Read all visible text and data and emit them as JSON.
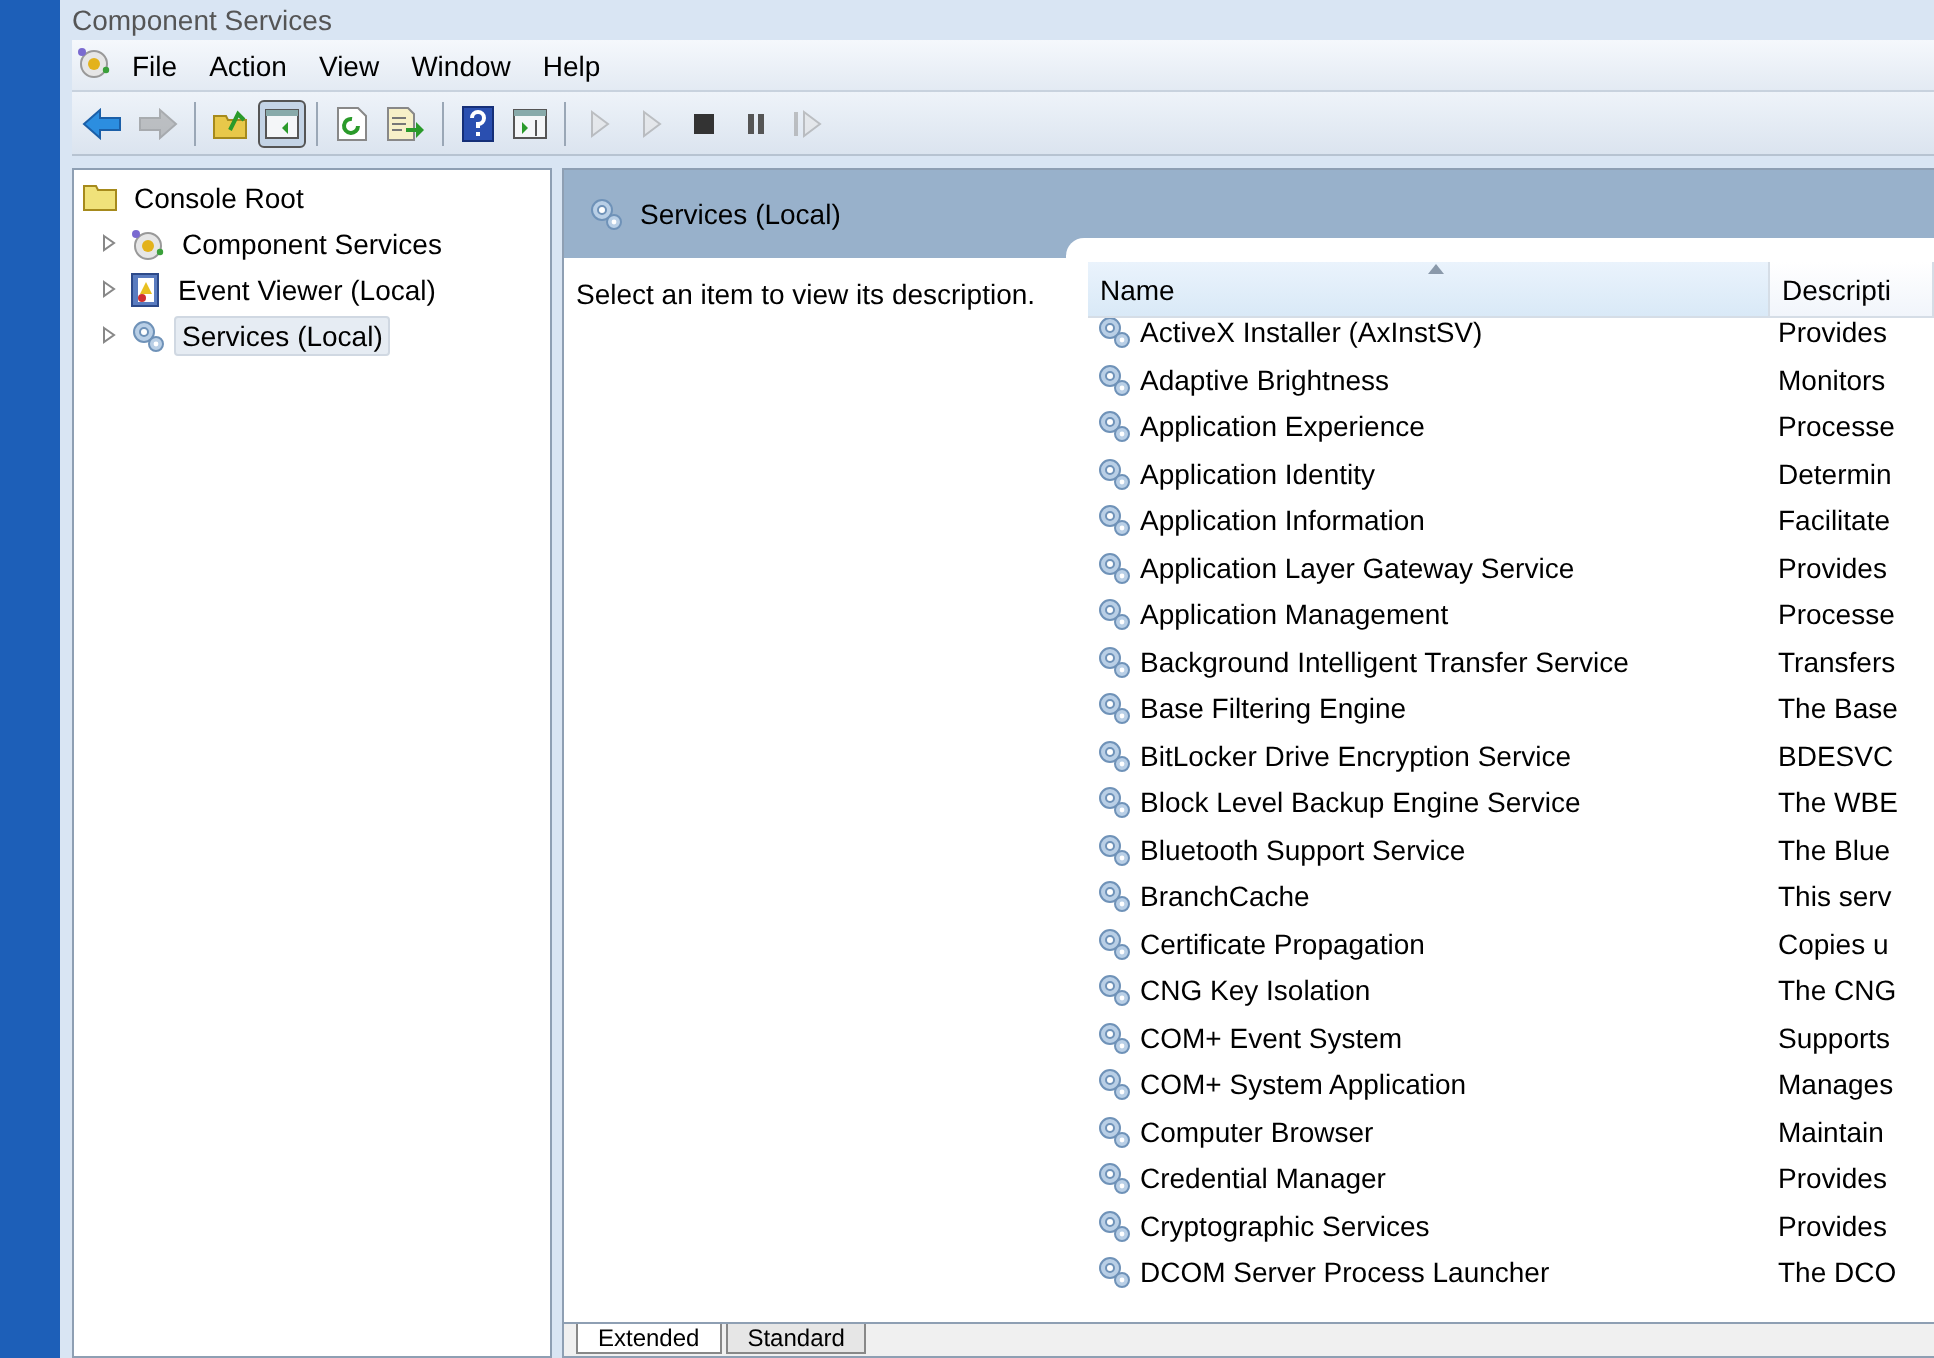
{
  "window": {
    "title": "Component Services"
  },
  "menu": [
    {
      "label": "File"
    },
    {
      "label": "Action"
    },
    {
      "label": "View"
    },
    {
      "label": "Window"
    },
    {
      "label": "Help"
    }
  ],
  "toolbar": [
    {
      "kind": "back",
      "disabled": false,
      "pressed": false
    },
    {
      "kind": "forward",
      "disabled": true,
      "pressed": false
    },
    {
      "kind": "separator"
    },
    {
      "kind": "up",
      "disabled": false,
      "pressed": false
    },
    {
      "kind": "tree",
      "disabled": false,
      "pressed": true
    },
    {
      "kind": "separator"
    },
    {
      "kind": "refresh",
      "disabled": false,
      "pressed": false
    },
    {
      "kind": "export",
      "disabled": false,
      "pressed": false
    },
    {
      "kind": "separator"
    },
    {
      "kind": "help",
      "disabled": false,
      "pressed": false
    },
    {
      "kind": "pane",
      "disabled": false,
      "pressed": false
    },
    {
      "kind": "separator"
    },
    {
      "kind": "play",
      "disabled": true,
      "pressed": false
    },
    {
      "kind": "play",
      "disabled": true,
      "pressed": false
    },
    {
      "kind": "stop",
      "disabled": false,
      "pressed": false
    },
    {
      "kind": "pause",
      "disabled": false,
      "pressed": false
    },
    {
      "kind": "restart",
      "disabled": true,
      "pressed": false
    }
  ],
  "tree": [
    {
      "label": "Console Root",
      "kind": "folder",
      "selected": false,
      "children": [
        {
          "label": "Component Services",
          "kind": "component",
          "selected": false,
          "expanded": false
        },
        {
          "label": "Event Viewer (Local)",
          "kind": "eventlog",
          "selected": false,
          "expanded": false
        },
        {
          "label": "Services (Local)",
          "kind": "services",
          "selected": true,
          "expanded": false
        }
      ]
    }
  ],
  "pane": {
    "title": "Services (Local)",
    "description": "Select an item to view its description."
  },
  "table": {
    "columns": [
      {
        "label": "Name",
        "sorted": true
      },
      {
        "label": "Descripti",
        "sorted": false
      }
    ],
    "rows": [
      [
        "ActiveX Installer (AxInstSV)",
        "Provides"
      ],
      [
        "Adaptive Brightness",
        "Monitors"
      ],
      [
        "Application Experience",
        "Processe"
      ],
      [
        "Application Identity",
        "Determin"
      ],
      [
        "Application Information",
        "Facilitate"
      ],
      [
        "Application Layer Gateway Service",
        "Provides"
      ],
      [
        "Application Management",
        "Processe"
      ],
      [
        "Background Intelligent Transfer Service",
        "Transfers"
      ],
      [
        "Base Filtering Engine",
        "The Base"
      ],
      [
        "BitLocker Drive Encryption Service",
        "BDESVC"
      ],
      [
        "Block Level Backup Engine Service",
        "The WBE"
      ],
      [
        "Bluetooth Support Service",
        "The Blue"
      ],
      [
        "BranchCache",
        "This serv"
      ],
      [
        "Certificate Propagation",
        "Copies u"
      ],
      [
        "CNG Key Isolation",
        "The CNG"
      ],
      [
        "COM+ Event System",
        "Supports"
      ],
      [
        "COM+ System Application",
        "Manages"
      ],
      [
        "Computer Browser",
        "Maintain"
      ],
      [
        "Credential Manager",
        "Provides"
      ],
      [
        "Cryptographic Services",
        "Provides"
      ],
      [
        "DCOM Server Process Launcher",
        "The DCO"
      ]
    ]
  },
  "tabs": [
    {
      "label": "Extended",
      "selected": true
    },
    {
      "label": "Standard",
      "selected": false
    }
  ]
}
